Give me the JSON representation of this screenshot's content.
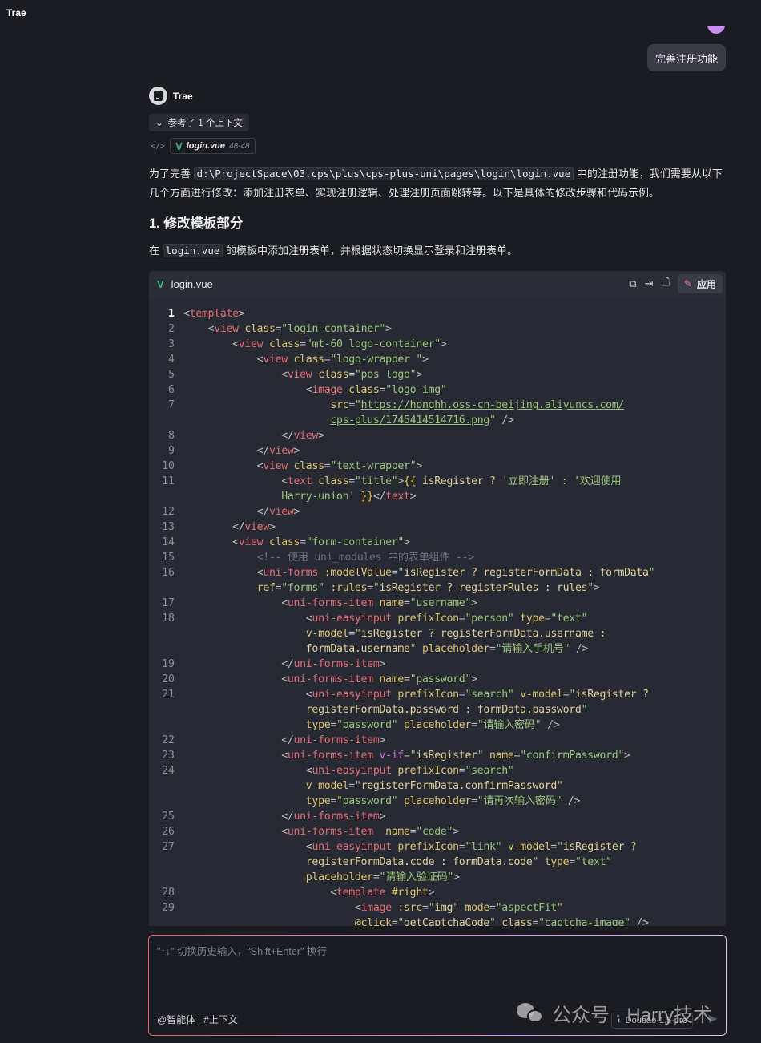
{
  "app": {
    "title": "Trae"
  },
  "user_message": "完善注册功能",
  "bot": {
    "name": "Trae"
  },
  "context": {
    "label": "参考了 1 个上下文",
    "file": "login.vue",
    "lines": "48-48"
  },
  "para1": {
    "before": "为了完善",
    "path": "d:\\ProjectSpace\\03.cps\\plus\\cps-plus-uni\\pages\\login\\login.vue",
    "after": "中的注册功能，我们需要从以下几个方面进行修改：添加注册表单、实现注册逻辑、处理注册页面跳转等。以下是具体的修改步骤和代码示例。"
  },
  "heading1": "1. 修改模板部分",
  "para2": {
    "before": "在",
    "file": "login.vue",
    "after": "的模板中添加注册表单，并根据状态切换显示登录和注册表单。"
  },
  "codeblock": {
    "filename": "login.vue",
    "apply_label": "应用",
    "icons": [
      "copy-icon",
      "insert-icon",
      "new-file-icon",
      "magic-wand-icon"
    ],
    "rows": [
      {
        "n": "1",
        "t": [
          [
            "p",
            "<"
          ],
          [
            "t",
            "template"
          ],
          [
            "p",
            ">"
          ]
        ]
      },
      {
        "n": "2",
        "t": [
          [
            "p",
            "    <"
          ],
          [
            "t",
            "view"
          ],
          [
            "a",
            " class"
          ],
          [
            "p",
            "="
          ],
          [
            "s",
            "\"login-container\""
          ],
          [
            "p",
            ">"
          ]
        ]
      },
      {
        "n": "3",
        "t": [
          [
            "p",
            "        <"
          ],
          [
            "t",
            "view"
          ],
          [
            "a",
            " class"
          ],
          [
            "p",
            "="
          ],
          [
            "s",
            "\"mt-60 logo-container\""
          ],
          [
            "p",
            ">"
          ]
        ]
      },
      {
        "n": "4",
        "t": [
          [
            "p",
            "            <"
          ],
          [
            "t",
            "view"
          ],
          [
            "a",
            " class"
          ],
          [
            "p",
            "="
          ],
          [
            "s",
            "\"logo-wrapper \""
          ],
          [
            "p",
            ">"
          ]
        ]
      },
      {
        "n": "5",
        "t": [
          [
            "p",
            "                <"
          ],
          [
            "t",
            "view"
          ],
          [
            "a",
            " class"
          ],
          [
            "p",
            "="
          ],
          [
            "s",
            "\"pos logo\""
          ],
          [
            "p",
            ">"
          ]
        ]
      },
      {
        "n": "6",
        "t": [
          [
            "p",
            "                    <"
          ],
          [
            "t",
            "image"
          ],
          [
            "a",
            " class"
          ],
          [
            "p",
            "="
          ],
          [
            "s",
            "\"logo-img\""
          ]
        ]
      },
      {
        "n": "7",
        "t": [
          [
            "a",
            "                        src"
          ],
          [
            "p",
            "="
          ],
          [
            "s",
            "\""
          ],
          [
            "u",
            "https://honghh.oss-cn-beijing.aliyuncs.com/"
          ]
        ]
      },
      {
        "n": "",
        "t": [
          [
            "p",
            "                        "
          ],
          [
            "u",
            "cps-plus/1745414514716.png"
          ],
          [
            "s",
            "\""
          ],
          [
            "p",
            " />"
          ]
        ]
      },
      {
        "n": "8",
        "t": [
          [
            "p",
            "                </"
          ],
          [
            "t",
            "view"
          ],
          [
            "p",
            ">"
          ]
        ]
      },
      {
        "n": "9",
        "t": [
          [
            "p",
            "            </"
          ],
          [
            "t",
            "view"
          ],
          [
            "p",
            ">"
          ]
        ]
      },
      {
        "n": "10",
        "t": [
          [
            "p",
            "            <"
          ],
          [
            "t",
            "view"
          ],
          [
            "a",
            " class"
          ],
          [
            "p",
            "="
          ],
          [
            "s",
            "\"text-wrapper\""
          ],
          [
            "p",
            ">"
          ]
        ]
      },
      {
        "n": "11",
        "t": [
          [
            "p",
            "                <"
          ],
          [
            "t",
            "text"
          ],
          [
            "a",
            " class"
          ],
          [
            "p",
            "="
          ],
          [
            "s",
            "\"title\""
          ],
          [
            "p",
            ">"
          ],
          [
            "b",
            "{{"
          ],
          [
            "e",
            " isRegister ? "
          ],
          [
            "s",
            "'立即注册'"
          ],
          [
            "e",
            " : "
          ],
          [
            "s",
            "'欢迎使用"
          ]
        ]
      },
      {
        "n": "",
        "t": [
          [
            "s",
            "                Harry-union'"
          ],
          [
            "b",
            " }}"
          ],
          [
            "p",
            "</"
          ],
          [
            "t",
            "text"
          ],
          [
            "p",
            ">"
          ]
        ]
      },
      {
        "n": "12",
        "t": [
          [
            "p",
            "            </"
          ],
          [
            "t",
            "view"
          ],
          [
            "p",
            ">"
          ]
        ]
      },
      {
        "n": "13",
        "t": [
          [
            "p",
            "        </"
          ],
          [
            "t",
            "view"
          ],
          [
            "p",
            ">"
          ]
        ]
      },
      {
        "n": "14",
        "t": [
          [
            "p",
            "        <"
          ],
          [
            "t",
            "view"
          ],
          [
            "a",
            " class"
          ],
          [
            "p",
            "="
          ],
          [
            "s",
            "\"form-container\""
          ],
          [
            "p",
            ">"
          ]
        ]
      },
      {
        "n": "15",
        "t": [
          [
            "c",
            "            <!-- 使用 uni_modules 中的表单组件 -->"
          ]
        ]
      },
      {
        "n": "16",
        "t": [
          [
            "p",
            "            <"
          ],
          [
            "t",
            "uni-forms"
          ],
          [
            "a",
            " :modelValue"
          ],
          [
            "p",
            "="
          ],
          [
            "s",
            "\""
          ],
          [
            "e",
            "isRegister ? registerFormData : formData"
          ],
          [
            "s",
            "\""
          ]
        ]
      },
      {
        "n": "",
        "t": [
          [
            "a",
            "            ref"
          ],
          [
            "p",
            "="
          ],
          [
            "s",
            "\"forms\""
          ],
          [
            "a",
            " :rules"
          ],
          [
            "p",
            "="
          ],
          [
            "s",
            "\""
          ],
          [
            "e",
            "isRegister ? registerRules : rules"
          ],
          [
            "s",
            "\""
          ],
          [
            "p",
            ">"
          ]
        ]
      },
      {
        "n": "17",
        "t": [
          [
            "p",
            "                <"
          ],
          [
            "t",
            "uni-forms-item"
          ],
          [
            "a",
            " name"
          ],
          [
            "p",
            "="
          ],
          [
            "s",
            "\"username\""
          ],
          [
            "p",
            ">"
          ]
        ]
      },
      {
        "n": "18",
        "t": [
          [
            "p",
            "                    <"
          ],
          [
            "t",
            "uni-easyinput"
          ],
          [
            "a",
            " prefixIcon"
          ],
          [
            "p",
            "="
          ],
          [
            "s",
            "\"person\""
          ],
          [
            "a",
            " type"
          ],
          [
            "p",
            "="
          ],
          [
            "s",
            "\"text\""
          ]
        ]
      },
      {
        "n": "",
        "t": [
          [
            "a",
            "                    v-model"
          ],
          [
            "p",
            "="
          ],
          [
            "s",
            "\""
          ],
          [
            "e",
            "isRegister ? registerFormData.username :"
          ]
        ]
      },
      {
        "n": "",
        "t": [
          [
            "e",
            "                    formData.username"
          ],
          [
            "s",
            "\""
          ],
          [
            "a",
            " placeholder"
          ],
          [
            "p",
            "="
          ],
          [
            "s",
            "\"请输入手机号\""
          ],
          [
            "p",
            " />"
          ]
        ]
      },
      {
        "n": "19",
        "t": [
          [
            "p",
            "                </"
          ],
          [
            "t",
            "uni-forms-item"
          ],
          [
            "p",
            ">"
          ]
        ]
      },
      {
        "n": "20",
        "t": [
          [
            "p",
            "                <"
          ],
          [
            "t",
            "uni-forms-item"
          ],
          [
            "a",
            " name"
          ],
          [
            "p",
            "="
          ],
          [
            "s",
            "\"password\""
          ],
          [
            "p",
            ">"
          ]
        ]
      },
      {
        "n": "21",
        "t": [
          [
            "p",
            "                    <"
          ],
          [
            "t",
            "uni-easyinput"
          ],
          [
            "a",
            " prefixIcon"
          ],
          [
            "p",
            "="
          ],
          [
            "s",
            "\"search\""
          ],
          [
            "a",
            " v-model"
          ],
          [
            "p",
            "="
          ],
          [
            "s",
            "\""
          ],
          [
            "e",
            "isRegister ?"
          ]
        ]
      },
      {
        "n": "",
        "t": [
          [
            "e",
            "                    registerFormData.password : formData.password"
          ],
          [
            "s",
            "\""
          ]
        ]
      },
      {
        "n": "",
        "t": [
          [
            "a",
            "                    type"
          ],
          [
            "p",
            "="
          ],
          [
            "s",
            "\"password\""
          ],
          [
            "a",
            " placeholder"
          ],
          [
            "p",
            "="
          ],
          [
            "s",
            "\"请输入密码\""
          ],
          [
            "p",
            " />"
          ]
        ]
      },
      {
        "n": "22",
        "t": [
          [
            "p",
            "                </"
          ],
          [
            "t",
            "uni-forms-item"
          ],
          [
            "p",
            ">"
          ]
        ]
      },
      {
        "n": "23",
        "t": [
          [
            "p",
            "                <"
          ],
          [
            "t",
            "uni-forms-item"
          ],
          [
            "k",
            " v-if"
          ],
          [
            "p",
            "="
          ],
          [
            "s",
            "\""
          ],
          [
            "e",
            "isRegister"
          ],
          [
            "s",
            "\""
          ],
          [
            "a",
            " name"
          ],
          [
            "p",
            "="
          ],
          [
            "s",
            "\"confirmPassword\""
          ],
          [
            "p",
            ">"
          ]
        ]
      },
      {
        "n": "24",
        "t": [
          [
            "p",
            "                    <"
          ],
          [
            "t",
            "uni-easyinput"
          ],
          [
            "a",
            " prefixIcon"
          ],
          [
            "p",
            "="
          ],
          [
            "s",
            "\"search\""
          ]
        ]
      },
      {
        "n": "",
        "t": [
          [
            "a",
            "                    v-model"
          ],
          [
            "p",
            "="
          ],
          [
            "s",
            "\""
          ],
          [
            "e",
            "registerFormData.confirmPassword"
          ],
          [
            "s",
            "\""
          ]
        ]
      },
      {
        "n": "",
        "t": [
          [
            "a",
            "                    type"
          ],
          [
            "p",
            "="
          ],
          [
            "s",
            "\"password\""
          ],
          [
            "a",
            " placeholder"
          ],
          [
            "p",
            "="
          ],
          [
            "s",
            "\"请再次输入密码\""
          ],
          [
            "p",
            " />"
          ]
        ]
      },
      {
        "n": "25",
        "t": [
          [
            "p",
            "                </"
          ],
          [
            "t",
            "uni-forms-item"
          ],
          [
            "p",
            ">"
          ]
        ]
      },
      {
        "n": "26",
        "t": [
          [
            "p",
            "                <"
          ],
          [
            "t",
            "uni-forms-item"
          ],
          [
            "a",
            "  name"
          ],
          [
            "p",
            "="
          ],
          [
            "s",
            "\"code\""
          ],
          [
            "p",
            ">"
          ]
        ]
      },
      {
        "n": "27",
        "t": [
          [
            "p",
            "                    <"
          ],
          [
            "t",
            "uni-easyinput"
          ],
          [
            "a",
            " prefixIcon"
          ],
          [
            "p",
            "="
          ],
          [
            "s",
            "\"link\""
          ],
          [
            "a",
            " v-model"
          ],
          [
            "p",
            "="
          ],
          [
            "s",
            "\""
          ],
          [
            "e",
            "isRegister ?"
          ]
        ]
      },
      {
        "n": "",
        "t": [
          [
            "e",
            "                    registerFormData.code : formData.code"
          ],
          [
            "s",
            "\""
          ],
          [
            "a",
            " type"
          ],
          [
            "p",
            "="
          ],
          [
            "s",
            "\"text\""
          ]
        ]
      },
      {
        "n": "",
        "t": [
          [
            "a",
            "                    placeholder"
          ],
          [
            "p",
            "="
          ],
          [
            "s",
            "\"请输入验证码\""
          ],
          [
            "p",
            ">"
          ]
        ]
      },
      {
        "n": "28",
        "t": [
          [
            "p",
            "                        <"
          ],
          [
            "t",
            "template"
          ],
          [
            "a",
            " #right"
          ],
          [
            "p",
            ">"
          ]
        ]
      },
      {
        "n": "29",
        "t": [
          [
            "p",
            "                            <"
          ],
          [
            "t",
            "image"
          ],
          [
            "a",
            " :src"
          ],
          [
            "p",
            "="
          ],
          [
            "s",
            "\""
          ],
          [
            "e",
            "img"
          ],
          [
            "s",
            "\""
          ],
          [
            "a",
            " mode"
          ],
          [
            "p",
            "="
          ],
          [
            "s",
            "\"aspectFit\""
          ]
        ]
      },
      {
        "n": "",
        "t": [
          [
            "a",
            "                            @click"
          ],
          [
            "p",
            "="
          ],
          [
            "s",
            "\""
          ],
          [
            "e",
            "getCaptchaCode"
          ],
          [
            "s",
            "\""
          ],
          [
            "a",
            " class"
          ],
          [
            "p",
            "="
          ],
          [
            "s",
            "\"captcha-image\""
          ],
          [
            "p",
            " />"
          ]
        ]
      }
    ]
  },
  "input": {
    "placeholder": "\"↑↓\" 切换历史输入，\"Shift+Enter\" 换行",
    "agent_label": "@智能体",
    "context_label": "#上下文",
    "model": "Doubao-1.5-pro"
  },
  "watermark": "公众号 · Harry技术",
  "colors": {
    "accent_gradient": [
      "#e9646a",
      "#d88cf0"
    ],
    "vue": "#41b883",
    "tag": "#e06c75",
    "attr": "#d9c26e",
    "string": "#98c379"
  }
}
